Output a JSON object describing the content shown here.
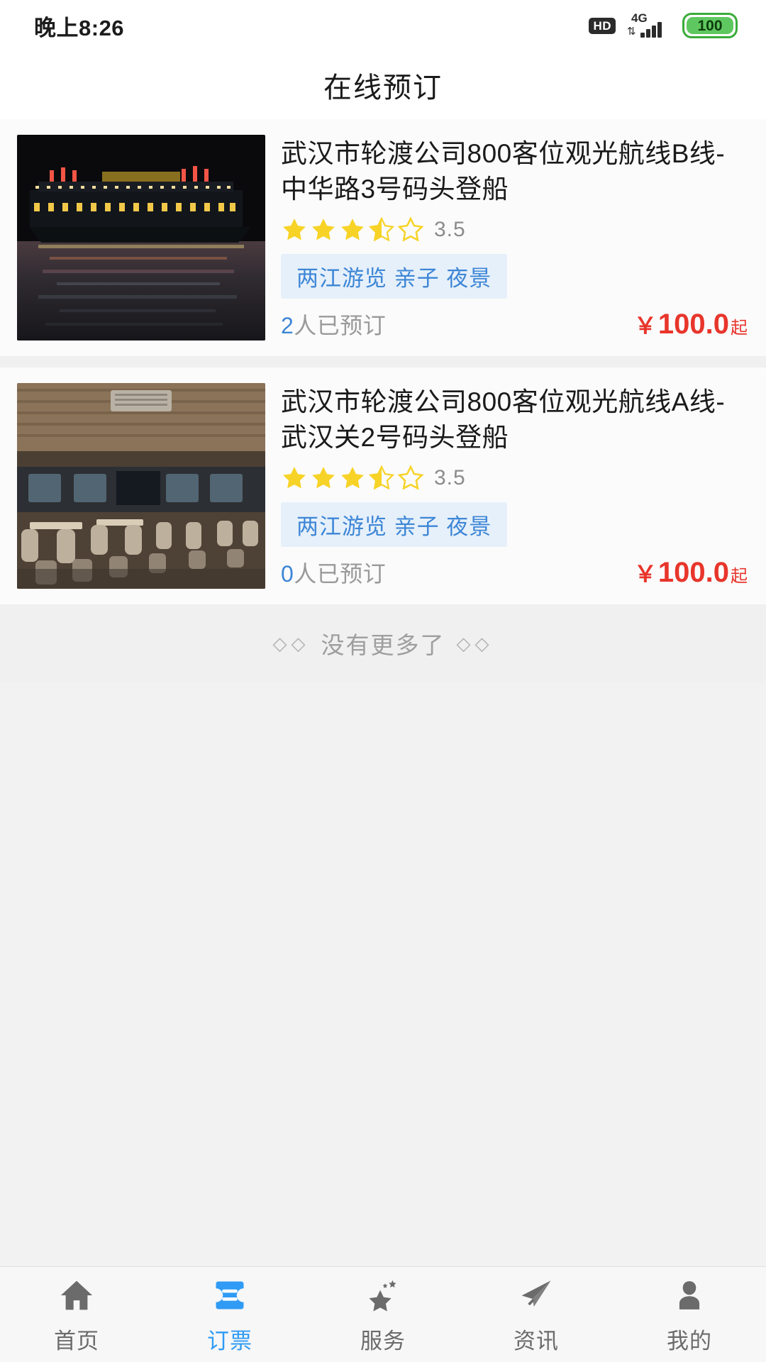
{
  "status_bar": {
    "time": "晚上8:26",
    "hd_label": "HD",
    "network": "4G",
    "battery_level": "100",
    "battery_color": "#5fc75f"
  },
  "header": {
    "title": "在线预订"
  },
  "theme": {
    "accent_blue": "#3d86d6",
    "tab_active_blue": "#2f9bf5",
    "price_red": "#e8352b",
    "star_yellow": "#f7d327",
    "tag_bg": "#e6f0fa"
  },
  "list": {
    "items": [
      {
        "title": "武汉市轮渡公司800客位观光航线B线-中华路3号码头登船",
        "rating": "3.5",
        "stars_full": 3,
        "stars_half": 1,
        "stars_empty": 1,
        "tags": "两江游览 亲子 夜景",
        "booked_count": "2",
        "booked_label": "人已预订",
        "currency": "￥",
        "price": "100.0",
        "price_suffix": "起",
        "image": "night-cruise-boat-photo"
      },
      {
        "title": "武汉市轮渡公司800客位观光航线A线-武汉关2号码头登船",
        "rating": "3.5",
        "stars_full": 3,
        "stars_half": 1,
        "stars_empty": 1,
        "tags": "两江游览 亲子 夜景",
        "booked_count": "0",
        "booked_label": "人已预订",
        "currency": "￥",
        "price": "100.0",
        "price_suffix": "起",
        "image": "boat-interior-cabin-photo"
      }
    ],
    "end_text": "没有更多了",
    "end_ornament_left": "◇◇",
    "end_ornament_right": "◇◇"
  },
  "tabbar": {
    "items": [
      {
        "label": "首页",
        "icon": "home-icon",
        "active": false
      },
      {
        "label": "订票",
        "icon": "ticket-icon",
        "active": true
      },
      {
        "label": "服务",
        "icon": "star-sparkle-icon",
        "active": false
      },
      {
        "label": "资讯",
        "icon": "paper-plane-icon",
        "active": false
      },
      {
        "label": "我的",
        "icon": "person-icon",
        "active": false
      }
    ]
  }
}
